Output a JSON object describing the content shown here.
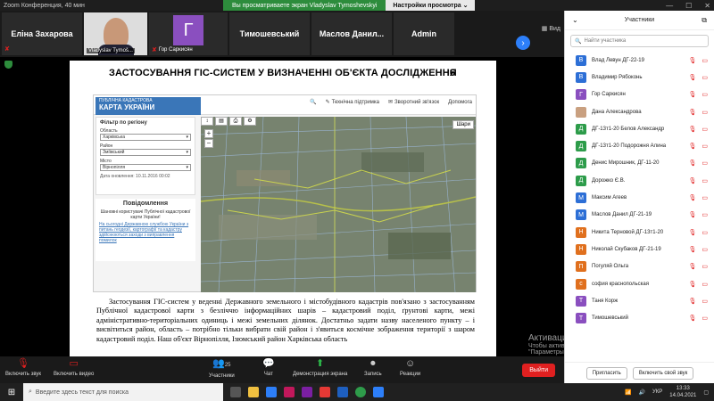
{
  "window": {
    "title": "Zoom Конференция, 40 мин",
    "share_msg": "Вы просматриваете экран Vladyslav Tymoshevskyi",
    "view_options": "Настройки просмотра ⌄",
    "view_label": "Вид"
  },
  "strip": {
    "tiles": [
      {
        "name": "Еліна Захарова"
      },
      {
        "name": "Vladyslav Tymoš..."
      },
      {
        "name": "Гор Саркисян",
        "letter": "Г"
      },
      {
        "name": "Тимошевський"
      },
      {
        "name": "Маслов Данил..."
      },
      {
        "name": "Admin"
      }
    ]
  },
  "slide": {
    "title": "ЗАСТОСУВАННЯ ГІС-СИСТЕМ У ВИЗНАЧЕННІ ОБ'ЄКТА ДОСЛІДЖЕННЯ",
    "number": "6",
    "map": {
      "logo_line1": "ПУБЛІЧНА КАДАСТРОВА",
      "logo_line2": "КАРТА УКРАЇНИ",
      "menu": [
        "Технічна підтримка",
        "Зворотний зв'язок",
        "Допомога"
      ],
      "filter_title": "Фільтр по регіону",
      "filter_fields": [
        {
          "label": "Область",
          "value": "Харківська"
        },
        {
          "label": "Район",
          "value": "Зміївський"
        },
        {
          "label": "Місто",
          "value": "Вірнопілля"
        }
      ],
      "filter_date": "Дата оновлення: 10.11.2016 00:02",
      "notice_title": "Повідомлення",
      "notice_text": "Шановні користувачі Публічної кадастрової карти України!",
      "notice_link": "На сьогодні Державною службою України з питань геодезії, картографії та кадастру здійснюються заходи з виправлення помилок",
      "chip": "Шари"
    },
    "text": "Застосування ГІС-систем у веденні Державного земельного і містобудівного кадастрів пов'язано з застосуванням Публічної кадастрової карти з безліччю інформаційних шарів – кадастровий поділ, ґрунтові карти, межі адміністративно-територіальних одиниць і межі земельних ділянок. Достатньо задати назву населеного пункту – і висвітиться район, область – потрібно тільки вибрати свій район і з'явиться космічне зображення території з шаром кадастровий поділ. Наш об'єкт Вірнопілля, Ізюмський район Харківська область"
  },
  "activation": {
    "title": "Активация Windows",
    "sub": "Чтобы активировать Windows, перейдите в раздел \"Параметры\"."
  },
  "toolbar": {
    "mute": "Включить звук",
    "video": "Включить видео",
    "participants": "Участники",
    "participants_count": "25",
    "chat": "Чат",
    "share": "Демонстрация экрана",
    "record": "Запись",
    "reactions": "Реакции",
    "leave": "Выйти"
  },
  "panel": {
    "title": "Участники",
    "search_placeholder": "Найти участника",
    "participants": [
      {
        "initial": "В",
        "name": "Влад Левун ДГ-22-19",
        "color": "#2d6fd6"
      },
      {
        "initial": "В",
        "name": "Владимир Рябоконь",
        "color": "#2d6fd6"
      },
      {
        "initial": "Г",
        "name": "Гор Саркисян",
        "color": "#8a4fbf"
      },
      {
        "initial": "",
        "name": "Дана Александрова",
        "color": "#c9a080"
      },
      {
        "initial": "Д",
        "name": "ДГ-13т1-20 Белов Александр",
        "color": "#2d9c4a"
      },
      {
        "initial": "Д",
        "name": "ДГ-13т1-20 Подорожня Алина",
        "color": "#2d9c4a"
      },
      {
        "initial": "Д",
        "name": "Денис Мирошник, ДГ-11-20",
        "color": "#2d9c4a"
      },
      {
        "initial": "Д",
        "name": "Дорожко Є.В.",
        "color": "#2d9c4a"
      },
      {
        "initial": "М",
        "name": "Максим Агеев",
        "color": "#2d6fd6"
      },
      {
        "initial": "М",
        "name": "Маслов Данил ДГ-21-19",
        "color": "#2d6fd6"
      },
      {
        "initial": "Н",
        "name": "Никита Терновой ДГ-13т1-20",
        "color": "#e0701e"
      },
      {
        "initial": "Н",
        "name": "Николай Скубаков ДГ-21-19",
        "color": "#e0701e"
      },
      {
        "initial": "П",
        "name": "Погуляй Ольга",
        "color": "#e0701e"
      },
      {
        "initial": "с",
        "name": "софия краснопольская",
        "color": "#e0701e"
      },
      {
        "initial": "Т",
        "name": "Таня Корж",
        "color": "#8a4fbf"
      },
      {
        "initial": "Т",
        "name": "Тимошевський",
        "color": "#8a4fbf"
      }
    ],
    "invite": "Пригласить",
    "unmute_me": "Включить свой звук"
  },
  "taskbar": {
    "search_placeholder": "Введите здесь текст для поиска",
    "lang": "УКР",
    "time": "13:33",
    "date": "14.04.2021"
  }
}
